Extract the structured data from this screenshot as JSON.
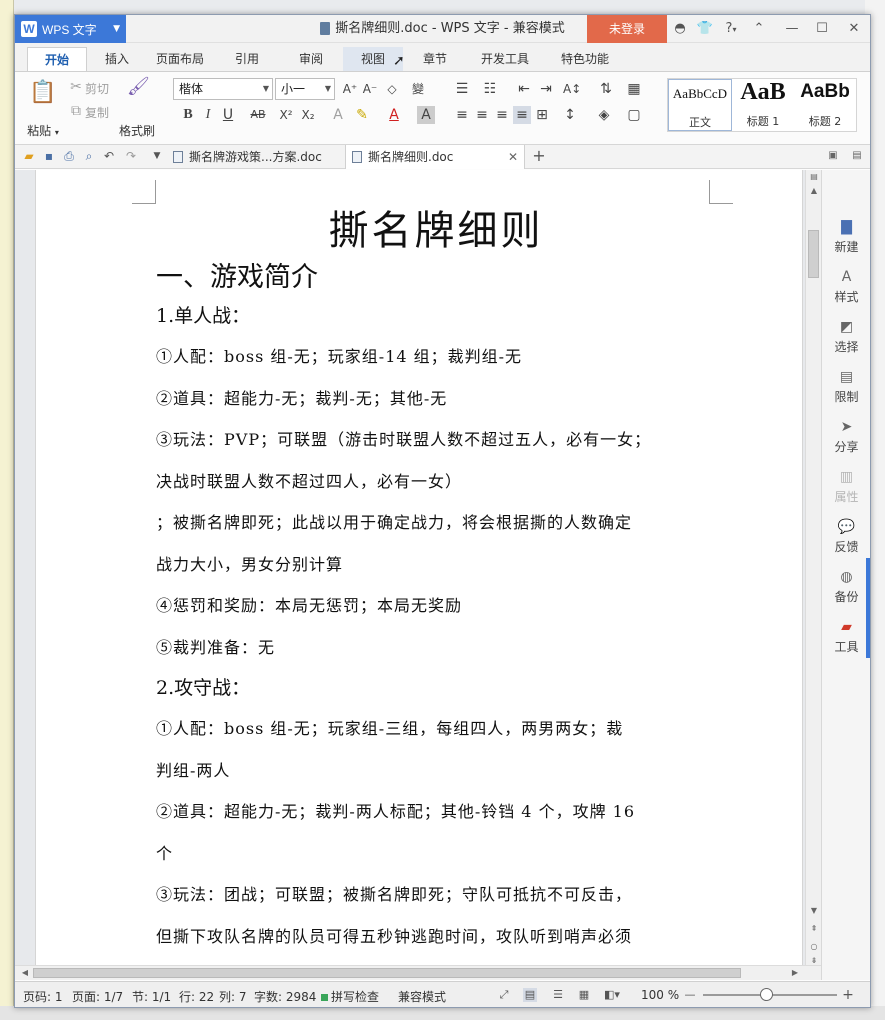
{
  "titlebar": {
    "app_name": "WPS 文字",
    "window_title": "撕名牌细则.doc - WPS 文字 - 兼容模式",
    "login": "未登录",
    "help": "?"
  },
  "ribbon_tabs": [
    "开始",
    "插入",
    "页面布局",
    "引用",
    "审阅",
    "视图",
    "章节",
    "开发工具",
    "特色功能"
  ],
  "ribbon": {
    "paste": "粘贴",
    "cut": "剪切",
    "copy": "复制",
    "format_painter": "格式刷",
    "font_name": "楷体",
    "font_size": "小一",
    "styles": [
      {
        "preview": "AaBbCcD",
        "label": "正文"
      },
      {
        "preview": "AaB",
        "label": "标题 1"
      },
      {
        "preview": "AaBb",
        "label": "标题 2"
      }
    ]
  },
  "doc_tabs": [
    {
      "label": "撕名牌游戏策...方案.doc"
    },
    {
      "label": "撕名牌细则.doc"
    }
  ],
  "document": {
    "title": "撕名牌细则",
    "section1": "一、游戏简介",
    "sub1": "1.单人战：",
    "lines_a": [
      "①人配：boss 组-无；玩家组-14 组；裁判组-无",
      "②道具：超能力-无；裁判-无；其他-无",
      "③玩法：PVP；可联盟（游击时联盟人数不超过五人，必有一女；",
      "决战时联盟人数不超过四人，必有一女）",
      "；被撕名牌即死；此战以用于确定战力，将会根据撕的人数确定",
      "战力大小，男女分别计算",
      "④惩罚和奖励：本局无惩罚；本局无奖励",
      "⑤裁判准备：无"
    ],
    "sub2": "2.攻守战：",
    "lines_b": [
      "①人配：boss 组-无；玩家组-三组，每组四人，两男两女；裁",
      "判组-两人",
      "②道具：超能力-无；裁判-两人标配；其他-铃铛 4 个，攻牌 16",
      "个",
      "③玩法：团战；可联盟；被撕名牌即死；守队可抵抗不可反击，",
      "但撕下攻队名牌的队员可得五秒钟逃跑时间，攻队听到哨声必须"
    ]
  },
  "taskpane": [
    "新建",
    "样式",
    "选择",
    "限制",
    "分享",
    "属性",
    "反馈",
    "备份",
    "工具"
  ],
  "status": {
    "page_code": "页码: 1",
    "pages": "页面: 1/7",
    "section": "节: 1/1",
    "row": "行: 22",
    "col": "列: 7",
    "word_count": "字数: 2984",
    "spell_check": "拼写检查",
    "compat": "兼容模式",
    "zoom": "100 %",
    "zoom_level": 1.0
  },
  "colors": {
    "accent": "#3c78d8",
    "login": "#e2694a"
  }
}
